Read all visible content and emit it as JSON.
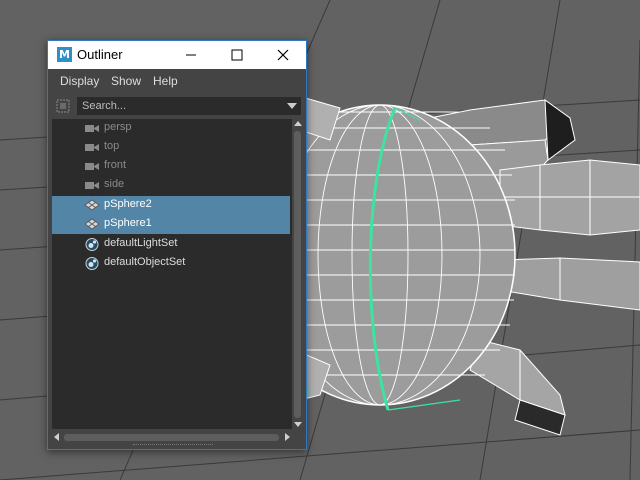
{
  "window": {
    "app_icon_letter": "M",
    "title": "Outliner"
  },
  "menu": {
    "items": [
      "Display",
      "Show",
      "Help"
    ]
  },
  "search": {
    "placeholder": "Search..."
  },
  "outliner_items": [
    {
      "label": "persp",
      "type": "camera",
      "selected": false,
      "dimmed": true
    },
    {
      "label": "top",
      "type": "camera",
      "selected": false,
      "dimmed": true
    },
    {
      "label": "front",
      "type": "camera",
      "selected": false,
      "dimmed": true
    },
    {
      "label": "side",
      "type": "camera",
      "selected": false,
      "dimmed": true
    },
    {
      "label": "pSphere2",
      "type": "mesh",
      "selected": true,
      "dimmed": false
    },
    {
      "label": "pSphere1",
      "type": "mesh",
      "selected": true,
      "dimmed": false
    },
    {
      "label": "defaultLightSet",
      "type": "set",
      "selected": false,
      "dimmed": false
    },
    {
      "label": "defaultObjectSet",
      "type": "set",
      "selected": false,
      "dimmed": false
    }
  ],
  "colors": {
    "selection": "#5285a6",
    "highlight_edge": "#3de3a0",
    "window_border": "#2f78c4",
    "viewport_bg": "#606060"
  }
}
